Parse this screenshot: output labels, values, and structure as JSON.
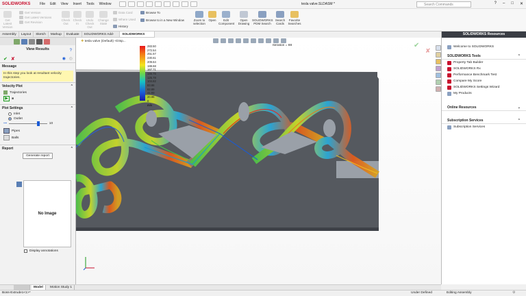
{
  "app": {
    "name": "SOLIDWORKS",
    "document_title": "tesla valve.SLDASM *"
  },
  "menus": [
    "File",
    "Edit",
    "View",
    "Insert",
    "Tools",
    "Window"
  ],
  "search": {
    "placeholder": "Search Commands"
  },
  "ribbon": {
    "buttons": [
      {
        "label": "Get Latest Version",
        "dim": true
      },
      {
        "label": "Get Version",
        "dim": true
      },
      {
        "label": "Get Latest Versions",
        "dim": true
      },
      {
        "label": "Get Revision",
        "dim": true
      },
      {
        "label": "Check Out",
        "dim": true
      },
      {
        "label": "Check In",
        "dim": true
      },
      {
        "label": "Undo Check Out",
        "dim": true
      },
      {
        "label": "Change State",
        "dim": true
      },
      {
        "label": "Data Card",
        "dim": true
      },
      {
        "label": "Where Used",
        "dim": true
      },
      {
        "label": "History",
        "dim": false
      },
      {
        "label": "Browse To",
        "dim": false
      },
      {
        "label": "Browse to in a New Window",
        "dim": false
      },
      {
        "label": "Zoom to selection",
        "dim": false
      },
      {
        "label": "Open",
        "dim": false
      },
      {
        "label": "Edit Component",
        "dim": false
      },
      {
        "label": "Open Drawing",
        "dim": false
      },
      {
        "label": "SOLIDWORKS PDM Search",
        "dim": false
      },
      {
        "label": "Search Cards",
        "dim": false
      },
      {
        "label": "Favorite Searches",
        "dim": false
      }
    ]
  },
  "tabs": [
    "Assembly",
    "Layout",
    "Sketch",
    "Markup",
    "Evaluate",
    "SOLIDWORKS Add-Ins",
    "SOLIDWORKS PDM"
  ],
  "active_tab": "SOLIDWORKS PDM",
  "left_panel": {
    "title": "View Results",
    "message_header": "Message",
    "message_text": "In this step you look at resultant velocity trajectories.",
    "velocity_plot_header": "Velocity Plot",
    "trajectories_label": "Trajectories",
    "plot_settings_header": "Plot Settings",
    "inlet_label": "Inlet",
    "outlet_label": "Outlet",
    "outlet_selected": true,
    "slider_value": "10",
    "slider_fraction": 0.8,
    "pipes_label": "Pipes",
    "balls_label": "Balls",
    "report_header": "Report",
    "generate_report_label": "Generate report",
    "no_image_label": "No Image",
    "display_annotations_label": "Display annotations"
  },
  "viewport": {
    "tree_label": "tesla valve (Default) <Disp...",
    "iteration_label": "Iteration = 88",
    "legend_values": [
      "283.50",
      "272.54",
      "251.57",
      "230.61",
      "209.64",
      "188.68",
      "167.71",
      "146.75",
      "125.78",
      "104.82",
      "83.86",
      "62.89",
      "41.93",
      "20.96",
      "0"
    ],
    "legend_unit": "m/s"
  },
  "task_pane": {
    "header": "SOLIDWORKS Resources",
    "welcome": "Welcome to SOLIDWORKS",
    "tools_header": "SOLIDWORKS Tools",
    "tools": [
      "Property Tab Builder",
      "SOLIDWORKS Rx",
      "Performance Benchmark Test",
      "Compare My Score",
      "SOLIDWORKS Settings Wizard",
      "My Products"
    ],
    "online_header": "Online Resources",
    "subscription_header": "Subscription Services",
    "subscription_items": [
      "Subscription Services"
    ]
  },
  "bottom_tabs": [
    "Model",
    "Motion Study 1"
  ],
  "status": {
    "left": "Boss-Extrude1<1>*",
    "state": "Under Defined",
    "mode": "Editing Assembly"
  },
  "colors": {
    "brand": "#c8102e",
    "task_header": "#3a3d44",
    "accent_blue": "#1a5bd6",
    "message_bg": "#fff7b0"
  }
}
